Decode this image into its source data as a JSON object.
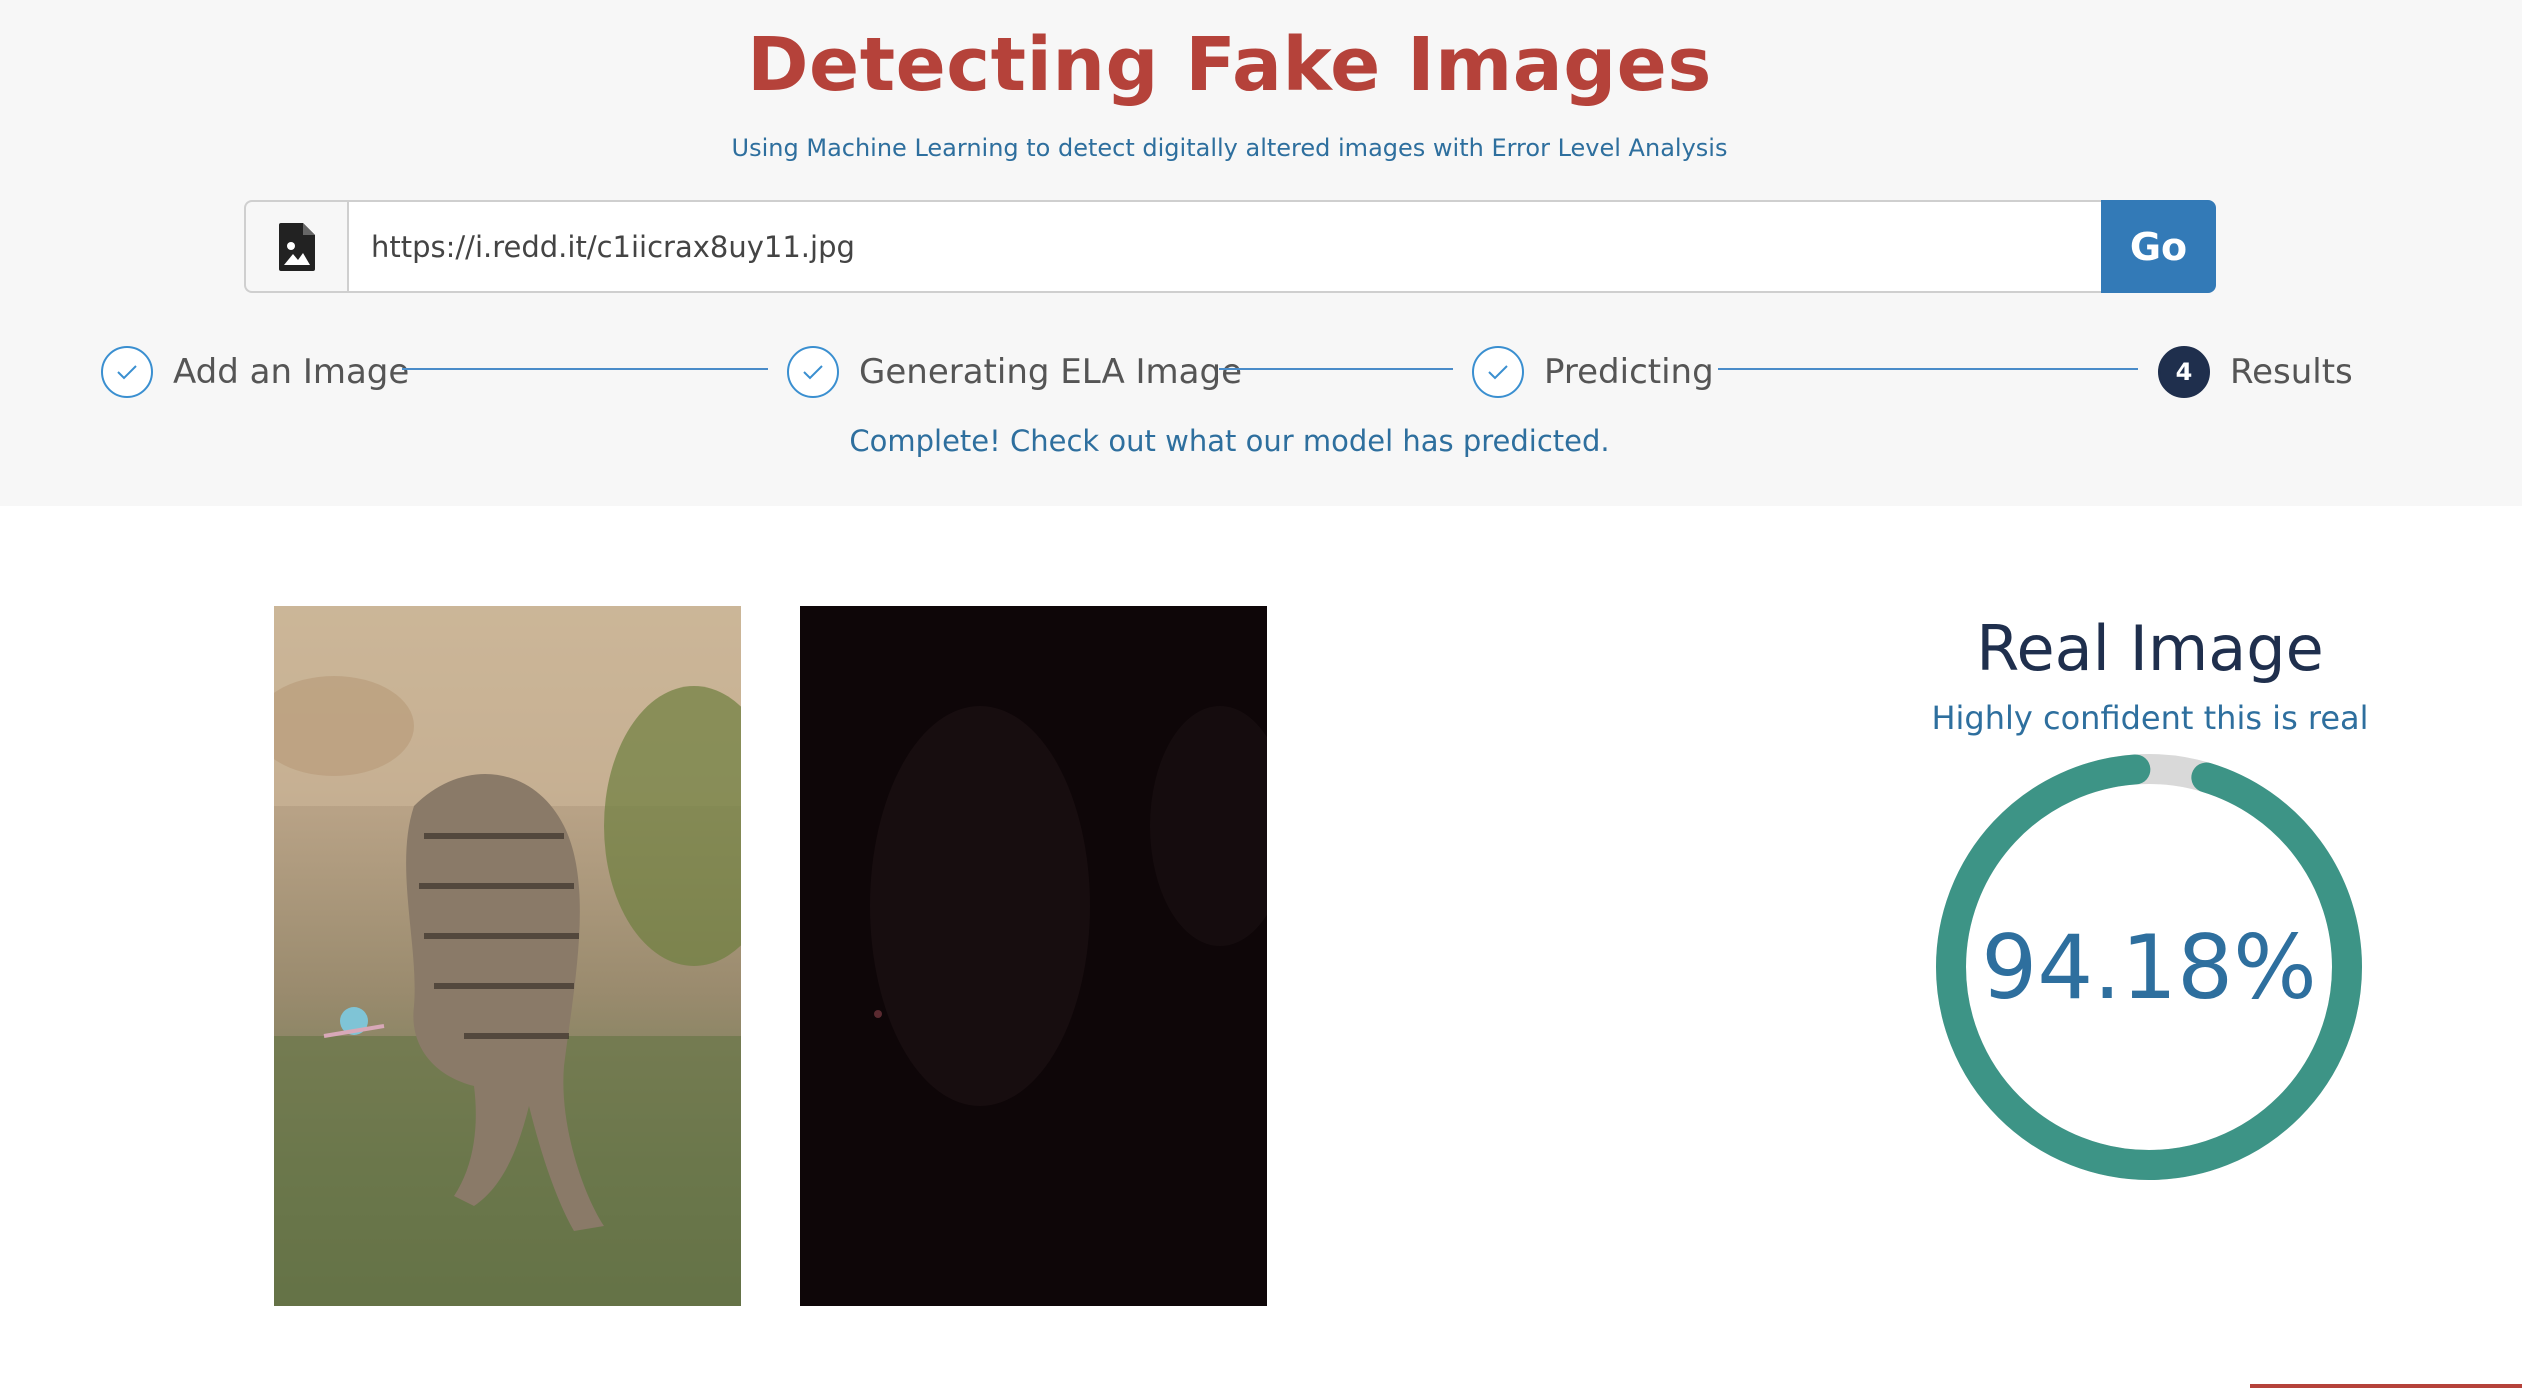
{
  "header": {
    "title": "Detecting Fake Images",
    "subtitle": "Using Machine Learning to detect digitally altered images with Error Level Analysis"
  },
  "url_bar": {
    "value": "https://i.redd.it/c1iicrax8uy11.jpg",
    "go_label": "Go",
    "file_icon": "image-file-icon"
  },
  "stepper": {
    "steps": [
      {
        "label": "Add an Image",
        "state": "done"
      },
      {
        "label": "Generating ELA Image",
        "state": "done"
      },
      {
        "label": "Predicting",
        "state": "done"
      },
      {
        "label": "Results",
        "state": "current",
        "number": "4"
      }
    ],
    "status": "Complete! Check out what our model has predicted."
  },
  "result": {
    "title": "Real Image",
    "subtitle": "Highly confident this is real",
    "confidence_text": "94.18%",
    "confidence_value": 94.18
  },
  "colors": {
    "accent_red": "#b5423a",
    "primary_blue": "#337ab7",
    "gauge_teal": "#3d9486",
    "gauge_track": "#d9d9d9"
  }
}
